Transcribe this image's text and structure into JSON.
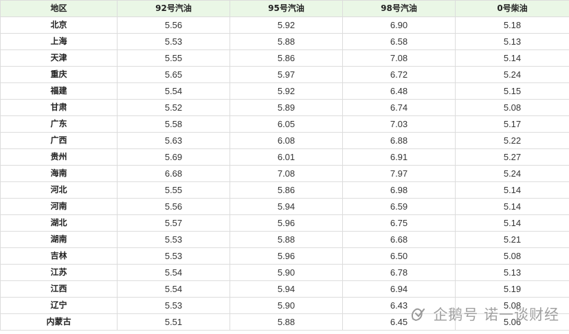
{
  "table": {
    "headers": [
      "地区",
      "92号汽油",
      "95号汽油",
      "98号汽油",
      "0号柴油"
    ],
    "rows": [
      [
        "北京",
        "5.56",
        "5.92",
        "6.90",
        "5.18"
      ],
      [
        "上海",
        "5.53",
        "5.88",
        "6.58",
        "5.13"
      ],
      [
        "天津",
        "5.55",
        "5.86",
        "7.08",
        "5.14"
      ],
      [
        "重庆",
        "5.65",
        "5.97",
        "6.72",
        "5.24"
      ],
      [
        "福建",
        "5.54",
        "5.92",
        "6.48",
        "5.15"
      ],
      [
        "甘肃",
        "5.52",
        "5.89",
        "6.74",
        "5.08"
      ],
      [
        "广东",
        "5.58",
        "6.05",
        "7.03",
        "5.17"
      ],
      [
        "广西",
        "5.63",
        "6.08",
        "6.88",
        "5.22"
      ],
      [
        "贵州",
        "5.69",
        "6.01",
        "6.91",
        "5.27"
      ],
      [
        "海南",
        "6.68",
        "7.08",
        "7.97",
        "5.24"
      ],
      [
        "河北",
        "5.55",
        "5.86",
        "6.98",
        "5.14"
      ],
      [
        "河南",
        "5.56",
        "5.94",
        "6.59",
        "5.14"
      ],
      [
        "湖北",
        "5.57",
        "5.96",
        "6.75",
        "5.14"
      ],
      [
        "湖南",
        "5.53",
        "5.88",
        "6.68",
        "5.21"
      ],
      [
        "吉林",
        "5.53",
        "5.96",
        "6.50",
        "5.08"
      ],
      [
        "江苏",
        "5.54",
        "5.90",
        "6.78",
        "5.13"
      ],
      [
        "江西",
        "5.54",
        "5.94",
        "6.94",
        "5.19"
      ],
      [
        "辽宁",
        "5.53",
        "5.90",
        "6.43",
        "5.08"
      ],
      [
        "内蒙古",
        "5.51",
        "5.88",
        "6.45",
        "5.06"
      ]
    ]
  },
  "watermark": {
    "text": "企鹅号 诺一谈财经",
    "icon": "penguin-logo-icon"
  },
  "colors": {
    "header_background": "#eaf7e6",
    "grid_line": "#dcdcdc",
    "text": "#333333"
  }
}
